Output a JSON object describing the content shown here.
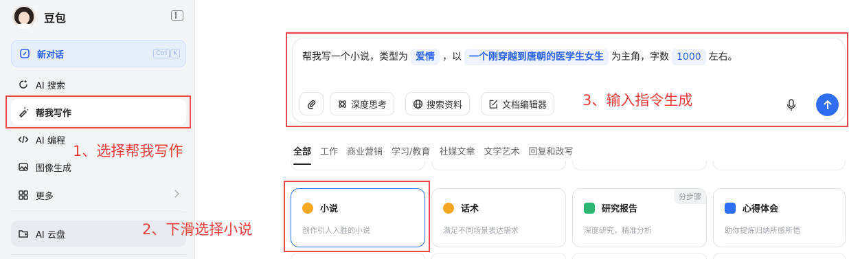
{
  "app": {
    "brand_name": "豆包",
    "shortcut_keys": [
      "Ctrl",
      "K"
    ]
  },
  "sidebar": {
    "new_chat_label": "新对话",
    "items": [
      {
        "label": "AI 搜索",
        "icon": "search-sparkle-icon"
      },
      {
        "label": "帮我写作",
        "icon": "pen-icon",
        "active": true
      },
      {
        "label": "AI 编程",
        "icon": "code-icon"
      },
      {
        "label": "图像生成",
        "icon": "image-icon"
      },
      {
        "label": "更多",
        "icon": "grid-icon"
      }
    ],
    "cloud_label": "AI 云盘"
  },
  "composer": {
    "prompt_prefix": "帮我写一个小说，类型为",
    "genre": "爱情",
    "prompt_mid": "，以",
    "protagonist": "一个刚穿越到唐朝的医学生女生",
    "prompt_mid2": "为主角，字数",
    "word_count": "1000",
    "prompt_suffix": "左右。",
    "tools": [
      "深度思考",
      "搜索资料",
      "文档编辑器"
    ]
  },
  "tabs": [
    "全部",
    "工作",
    "商业营销",
    "学习/教育",
    "社媒文章",
    "文学艺术",
    "回复和改写"
  ],
  "cards": [
    {
      "title": "小说",
      "desc": "创作引人入胜的小说",
      "icon_color": "#f5a623",
      "selected": true
    },
    {
      "title": "话术",
      "desc": "满足不同场景表达需求",
      "icon_color": "#f5a623"
    },
    {
      "title": "研究报告",
      "desc": "深度研究，精准分析",
      "icon_color": "#2bb673",
      "badge": "分步骤"
    },
    {
      "title": "心得体会",
      "desc": "助你提炼归纳所感所悟",
      "icon_color": "#2f6ef0"
    }
  ],
  "annotations": {
    "step1": "1、选择帮我写作",
    "step2": "2、下滑选择小说",
    "step3": "3、输入指令生成"
  },
  "colors": {
    "accent": "#2f6ef0",
    "annotation_red": "#e8403d"
  }
}
